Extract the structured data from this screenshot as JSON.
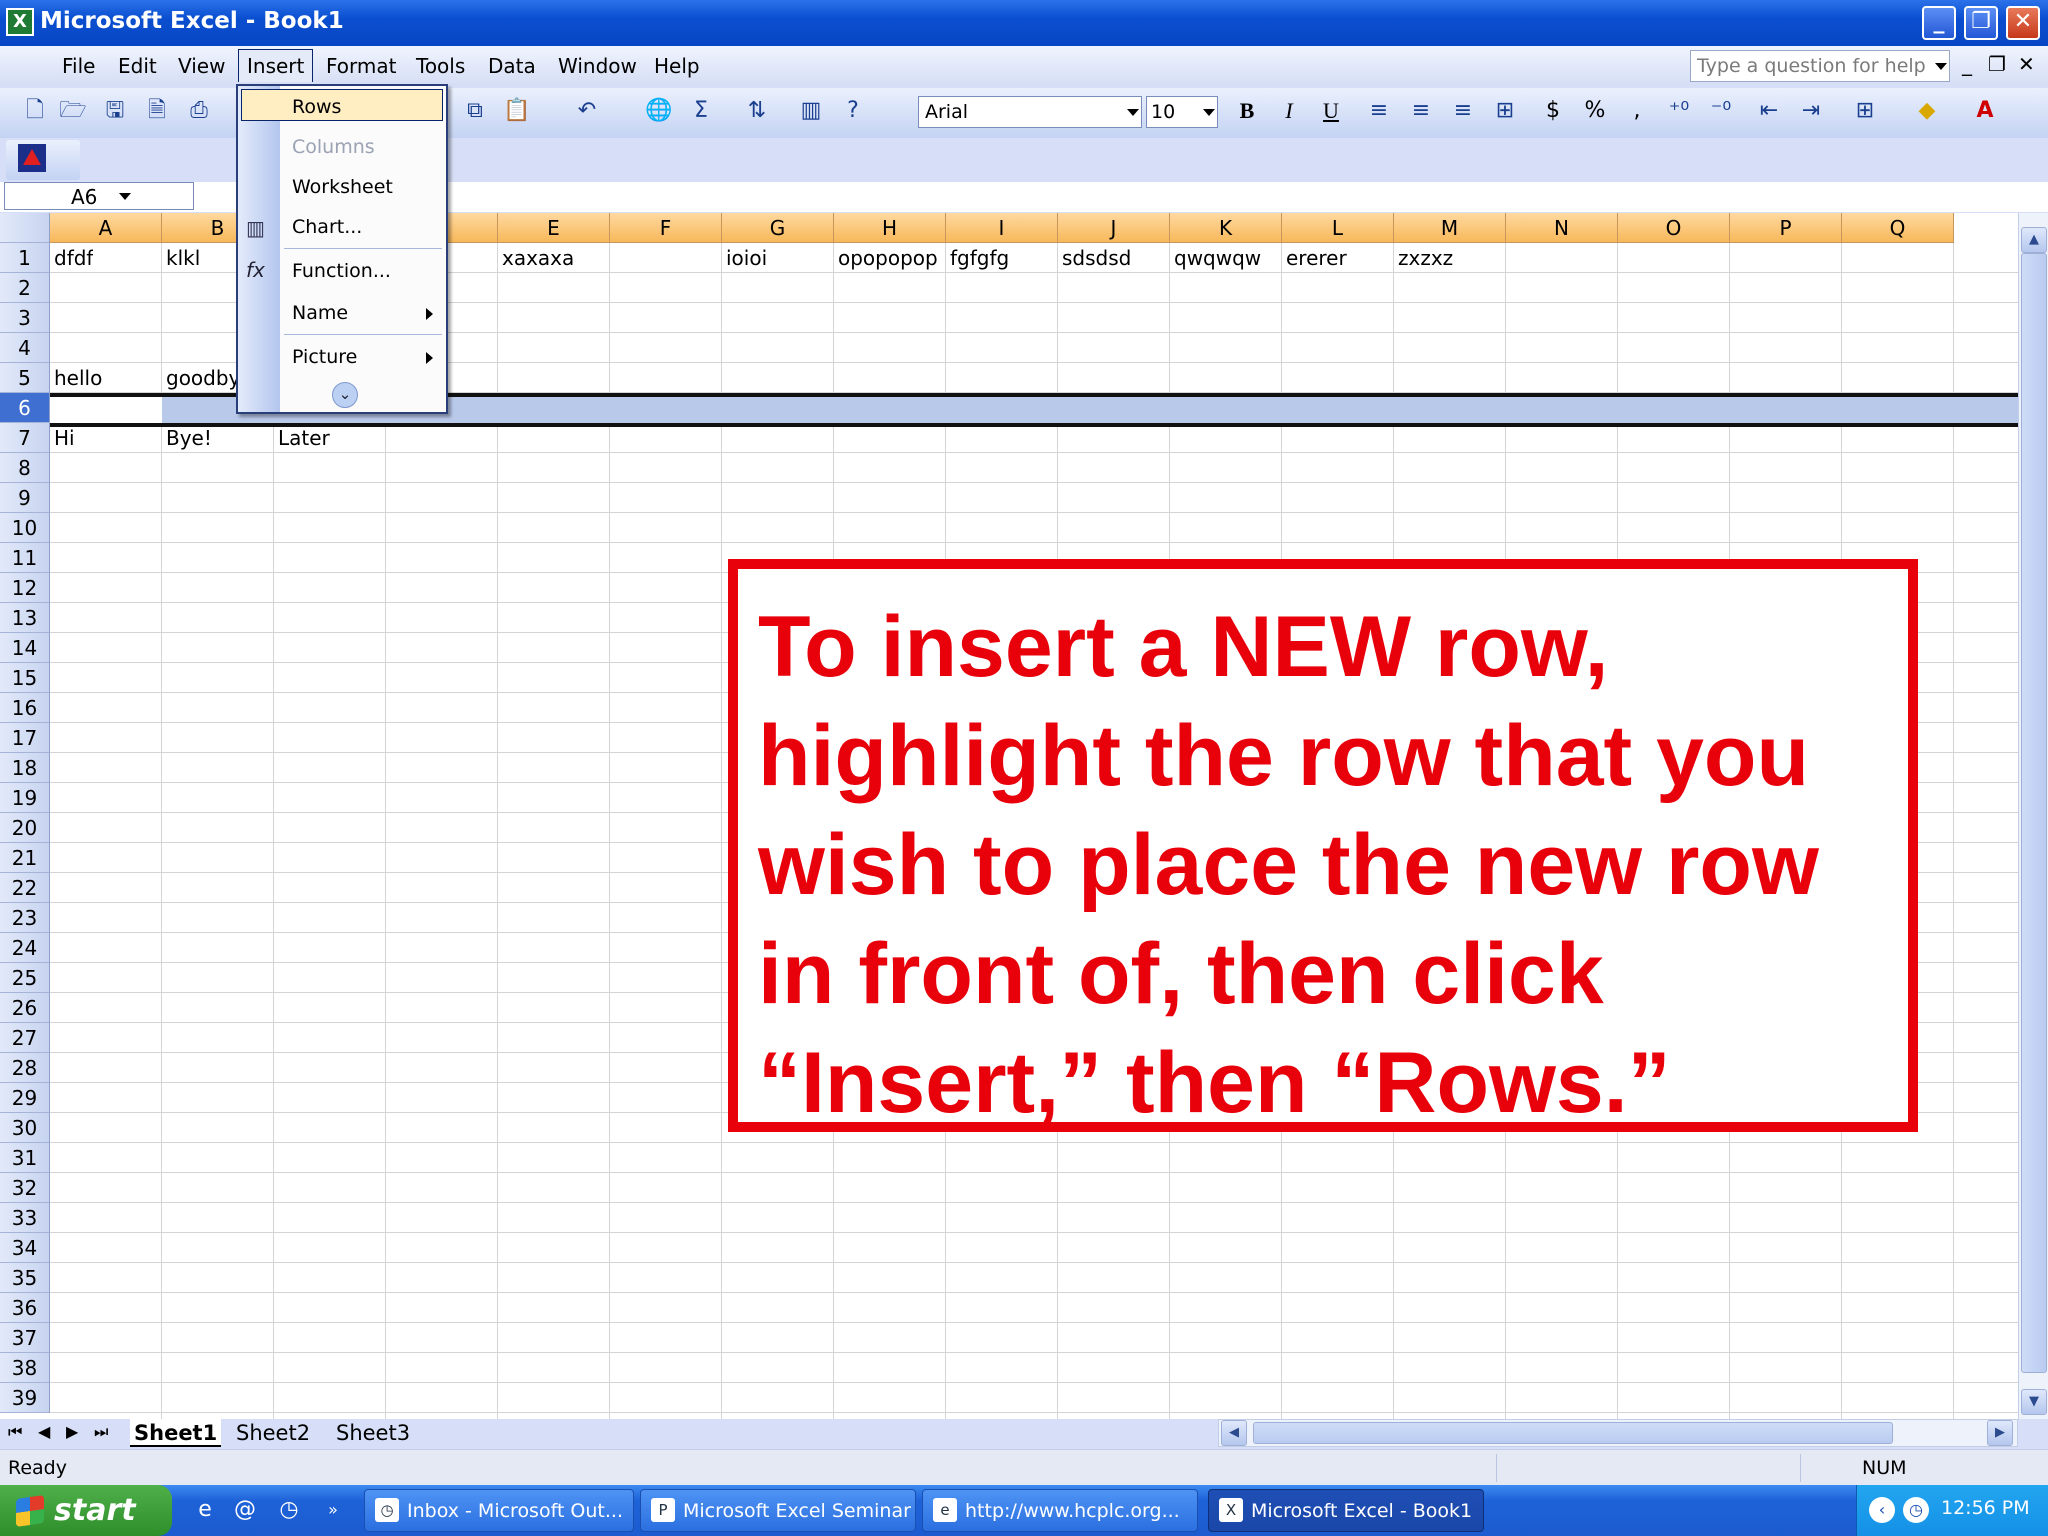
{
  "window": {
    "title": "Microsoft Excel - Book1",
    "app_icon": "excel-icon",
    "minimize": "_",
    "restore": "❐",
    "close": "✕"
  },
  "menubar": {
    "items": [
      "File",
      "Edit",
      "View",
      "Insert",
      "Format",
      "Tools",
      "Data",
      "Window",
      "Help"
    ],
    "open_menu": "Insert",
    "help_placeholder": "Type a question for help",
    "mdi_controls": [
      "_",
      "❐",
      "✕"
    ]
  },
  "toolbar": {
    "font": "Arial",
    "size": "10",
    "bold": "B",
    "italic": "I",
    "underline": "U",
    "currency": "$",
    "percent": "%",
    "comma": ",",
    "sum": "Σ"
  },
  "formula_bar": {
    "name_box": "A6"
  },
  "grid": {
    "columns": [
      "A",
      "B",
      "C",
      "D",
      "E",
      "F",
      "G",
      "H",
      "I",
      "J",
      "K",
      "L",
      "M",
      "N",
      "O",
      "P",
      "Q"
    ],
    "visible_column_headers": [
      "A",
      "B",
      "",
      "D",
      "E",
      "F",
      "G",
      "H",
      "I",
      "J",
      "K",
      "L",
      "M",
      "N",
      "O",
      "P",
      "Q"
    ],
    "rows": [
      "1",
      "2",
      "3",
      "4",
      "5",
      "6",
      "7",
      "8",
      "9",
      "10",
      "11",
      "12",
      "13",
      "14",
      "15",
      "16",
      "17",
      "18",
      "19",
      "20",
      "21",
      "22",
      "23",
      "24",
      "25",
      "26",
      "27",
      "28",
      "29",
      "30",
      "31",
      "32",
      "33",
      "34",
      "35",
      "36",
      "37",
      "38",
      "39"
    ],
    "selected_row": "6",
    "cells": [
      {
        "ref": "A1",
        "value": "dfdf"
      },
      {
        "ref": "B1",
        "value": "klkl"
      },
      {
        "ref": "E1",
        "value": "xaxaxa"
      },
      {
        "ref": "G1",
        "value": "ioioi"
      },
      {
        "ref": "H1",
        "value": "opopopop"
      },
      {
        "ref": "I1",
        "value": "fgfgfg"
      },
      {
        "ref": "J1",
        "value": "sdsdsd"
      },
      {
        "ref": "K1",
        "value": "qwqwqw"
      },
      {
        "ref": "L1",
        "value": "ererer"
      },
      {
        "ref": "M1",
        "value": "zxzxz"
      },
      {
        "ref": "A5",
        "value": "hello"
      },
      {
        "ref": "B5",
        "value": "goodby"
      },
      {
        "ref": "A7",
        "value": "Hi"
      },
      {
        "ref": "B7",
        "value": "Bye!"
      },
      {
        "ref": "C7",
        "value": "Later"
      }
    ]
  },
  "insert_menu": {
    "items": [
      {
        "label": "Rows",
        "enabled": true,
        "highlighted": true
      },
      {
        "label": "Columns",
        "enabled": false
      },
      {
        "label": "Worksheet",
        "enabled": true
      },
      {
        "label": "Chart...",
        "enabled": true,
        "icon": "chart-icon"
      },
      {
        "label": "Function...",
        "enabled": true,
        "icon": "fx-icon"
      },
      {
        "label": "Name",
        "enabled": true,
        "submenu": true
      },
      {
        "label": "Picture",
        "enabled": true,
        "submenu": true
      }
    ],
    "expand_icon": "chevron-double-down-icon"
  },
  "callout": {
    "text": "To insert a NEW row, highlight the row that you wish to place the new row in front of, then click “Insert,” then “Rows.”",
    "color": "#e8000b"
  },
  "sheet_tabs": [
    "Sheet1",
    "Sheet2",
    "Sheet3"
  ],
  "active_sheet": "Sheet1",
  "statusbar": {
    "status": "Ready",
    "num": "NUM"
  },
  "taskbar": {
    "start": "start",
    "tasks": [
      {
        "label": "Inbox - Microsoft Out...",
        "icon": "outlook-icon"
      },
      {
        "label": "Microsoft Excel Seminar",
        "icon": "powerpoint-icon"
      },
      {
        "label": "http://www.hcplc.org...",
        "icon": "internet-explorer-icon"
      },
      {
        "label": "Microsoft Excel - Book1",
        "icon": "excel-icon",
        "active": true
      }
    ],
    "clock": "12:56 PM"
  }
}
